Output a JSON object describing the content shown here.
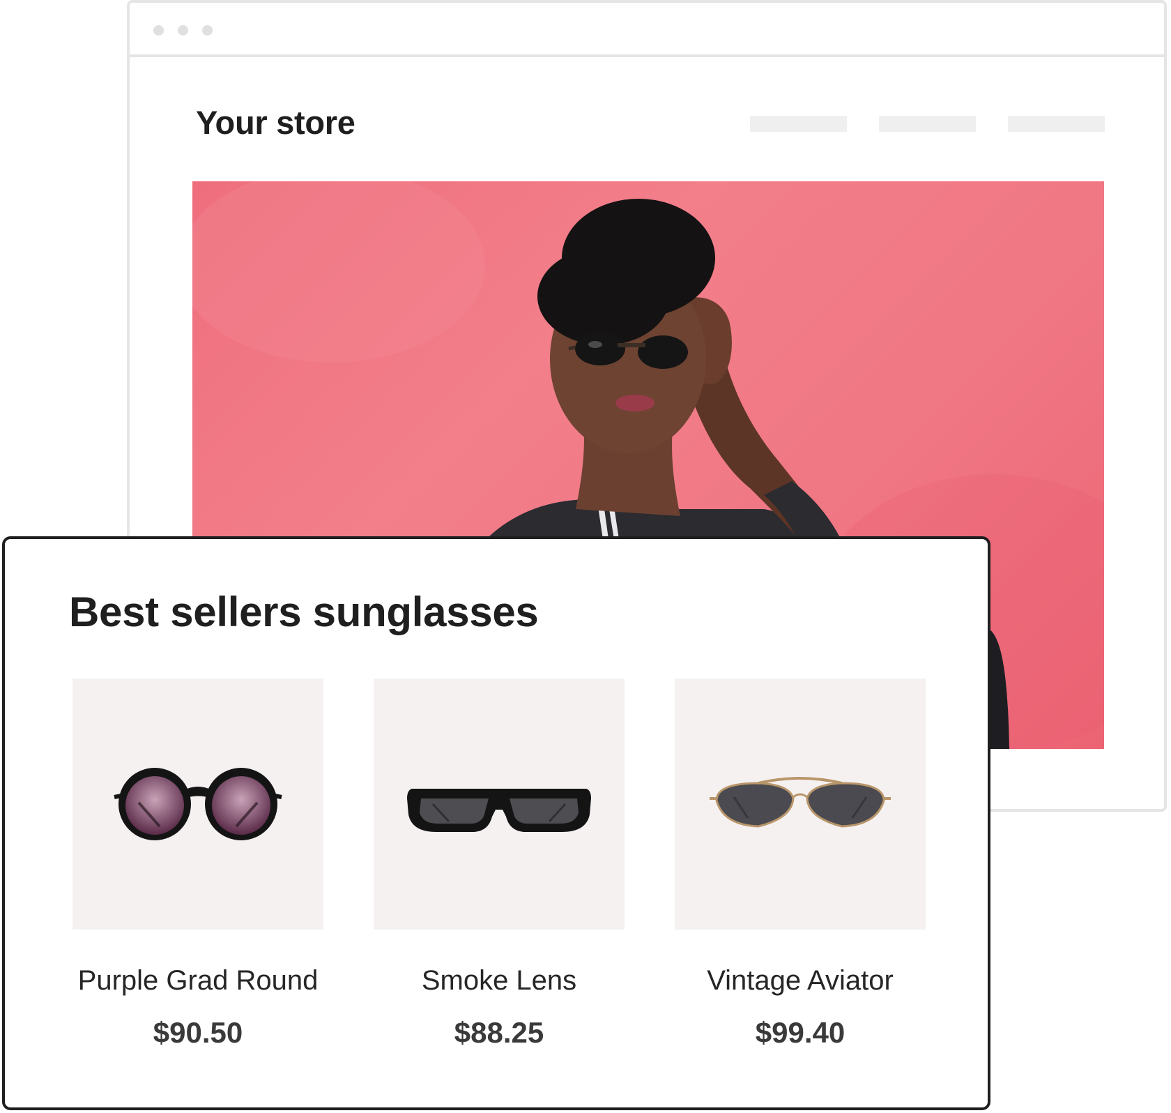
{
  "store": {
    "title": "Your store"
  },
  "hero": {
    "description_icon": "model-wearing-sunglasses-photo",
    "background_color": "#F07784"
  },
  "best_sellers": {
    "title": "Best sellers sunglasses",
    "products": [
      {
        "name": "Purple Grad Round",
        "price": "$90.50",
        "icon": "round-sunglasses-icon"
      },
      {
        "name": "Smoke Lens",
        "price": "$88.25",
        "icon": "rectangular-sunglasses-icon"
      },
      {
        "name": "Vintage Aviator",
        "price": "$99.40",
        "icon": "aviator-sunglasses-icon"
      }
    ]
  },
  "colors": {
    "accent_pink": "#F07784",
    "text_dark": "#1F1F1F",
    "product_bg": "#F6F1F1",
    "border_light": "#E5E5E5"
  }
}
